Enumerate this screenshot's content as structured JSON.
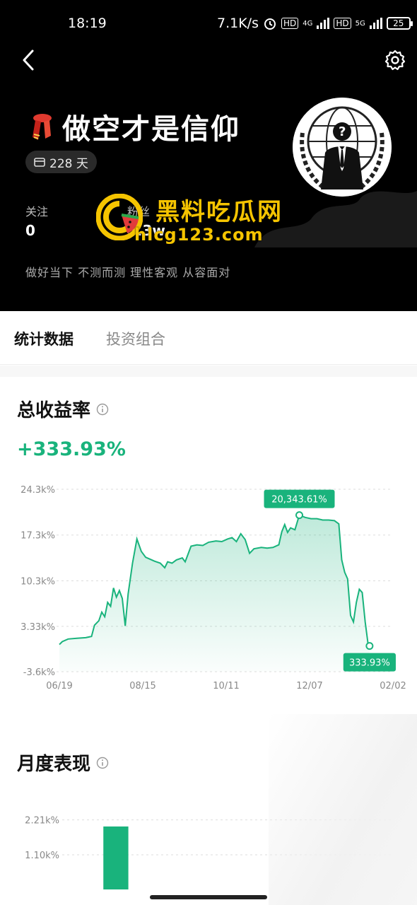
{
  "status_bar": {
    "time": "18:19",
    "net_speed": "7.1K/s",
    "hd1": "HD",
    "sig1": "4G",
    "hd2": "HD",
    "sig2": "5G",
    "battery": "25"
  },
  "profile": {
    "username": "做空才是信仰",
    "days_badge": "228 天",
    "follow_label": "关注",
    "follow_count": "0",
    "fans_label": "粉丝",
    "fans_count": "5.3w",
    "bio": "做好当下 不测而测 理性客观 从容面对"
  },
  "watermark": {
    "line1": "黑料吃瓜网",
    "line2": "hlcg123.com"
  },
  "tabs": [
    {
      "label": "统计数据",
      "active": true
    },
    {
      "label": "投资组合",
      "active": false
    }
  ],
  "total_return_section": {
    "title": "总收益率",
    "value": "+333.93%"
  },
  "monthly_section": {
    "title": "月度表现"
  },
  "colors": {
    "accent": "#19b37c",
    "hero_bg": "#000000",
    "watermark": "#f5c400"
  },
  "chart_data": [
    {
      "type": "area",
      "yticks": [
        "24.3k%",
        "17.3k%",
        "10.3k%",
        "3.33k%",
        "-3.6k%"
      ],
      "ytick_values": [
        24300,
        17300,
        10300,
        3330,
        -3600
      ],
      "ylim": [
        -3600,
        24300
      ],
      "xticks": [
        "06/19",
        "08/15",
        "10/11",
        "12/07",
        "02/02"
      ],
      "xtick_positions": [
        0,
        57,
        114,
        171,
        228
      ],
      "xlim": [
        0,
        228
      ],
      "grid": true,
      "series": [
        {
          "points": [
            [
              0,
              550
            ],
            [
              2,
              1000
            ],
            [
              6,
              1400
            ],
            [
              12,
              1500
            ],
            [
              18,
              1600
            ],
            [
              22,
              1800
            ],
            [
              24,
              3500
            ],
            [
              27,
              4200
            ],
            [
              29,
              5500
            ],
            [
              31,
              4800
            ],
            [
              33,
              7000
            ],
            [
              35,
              6400
            ],
            [
              37,
              9200
            ],
            [
              39,
              7800
            ],
            [
              41,
              8800
            ],
            [
              43,
              7600
            ],
            [
              45,
              3400
            ],
            [
              47,
              8300
            ],
            [
              50,
              13000
            ],
            [
              53,
              16700
            ],
            [
              56,
              14800
            ],
            [
              59,
              13900
            ],
            [
              62,
              13600
            ],
            [
              65,
              13300
            ],
            [
              69,
              13000
            ],
            [
              72,
              12300
            ],
            [
              74,
              13200
            ],
            [
              77,
              13000
            ],
            [
              80,
              13500
            ],
            [
              84,
              13800
            ],
            [
              86,
              13200
            ],
            [
              90,
              15600
            ],
            [
              94,
              15800
            ],
            [
              98,
              15700
            ],
            [
              102,
              16200
            ],
            [
              107,
              16400
            ],
            [
              111,
              16300
            ],
            [
              115,
              16700
            ],
            [
              118,
              16900
            ],
            [
              121,
              16300
            ],
            [
              124,
              17500
            ],
            [
              127,
              16600
            ],
            [
              130,
              14500
            ],
            [
              133,
              15200
            ],
            [
              138,
              15400
            ],
            [
              142,
              15300
            ],
            [
              146,
              15400
            ],
            [
              150,
              15800
            ],
            [
              152,
              17800
            ],
            [
              154,
              18900
            ],
            [
              156,
              17700
            ],
            [
              158,
              18400
            ],
            [
              161,
              18100
            ],
            [
              164,
              20343
            ],
            [
              168,
              20000
            ],
            [
              172,
              19800
            ],
            [
              176,
              19800
            ],
            [
              180,
              19600
            ],
            [
              184,
              19600
            ],
            [
              188,
              19500
            ],
            [
              191,
              19000
            ],
            [
              193,
              13500
            ],
            [
              195,
              11600
            ],
            [
              197,
              10600
            ],
            [
              199,
              5000
            ],
            [
              201,
              4000
            ],
            [
              203,
              7000
            ],
            [
              205,
              9000
            ],
            [
              207,
              8500
            ],
            [
              209,
              4000
            ],
            [
              211,
              600
            ],
            [
              212,
              334
            ]
          ]
        }
      ],
      "annotations": [
        {
          "label": "20,343.61%",
          "x": 164,
          "y": 20343
        },
        {
          "label": "333.93%",
          "x": 212,
          "y": 334
        }
      ]
    },
    {
      "type": "bar",
      "yticks": [
        "2.21k%",
        "1.10k%"
      ],
      "ytick_values": [
        2210,
        1100
      ],
      "ylim": [
        0,
        2650
      ],
      "grid": true,
      "values": [
        0,
        2000,
        0,
        0,
        0,
        0,
        0,
        0,
        0
      ]
    }
  ]
}
